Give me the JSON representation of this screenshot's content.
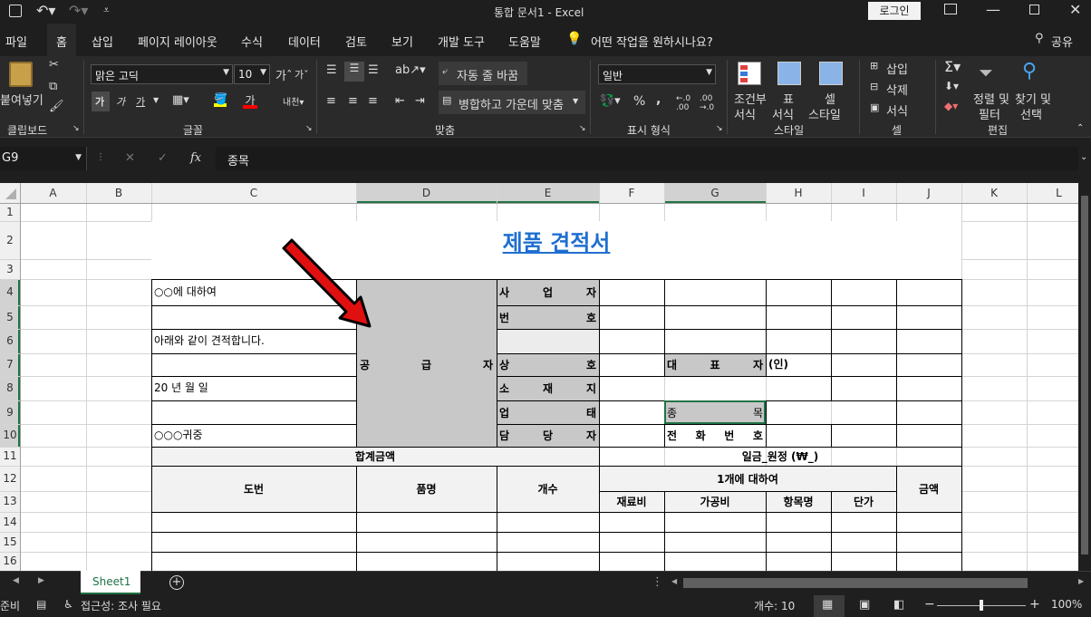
{
  "titlebar": {
    "title": "통합 문서1  -  Excel",
    "login": "로그인",
    "undo_icon": "undo-icon",
    "redo_icon": "redo-icon"
  },
  "menu": {
    "tabs": [
      "파일",
      "홈",
      "삽입",
      "페이지 레이아웃",
      "수식",
      "데이터",
      "검토",
      "보기",
      "개발 도구",
      "도움말"
    ],
    "tell": "어떤 작업을 원하시나요?",
    "share": "공유"
  },
  "ribbon": {
    "paste": "붙여넣기",
    "clipboard": "클립보드",
    "font_name": "맑은 고딕",
    "font_size": "10",
    "bold": "가",
    "italic": "가",
    "underline": "가",
    "font_group": "글꼴",
    "wrap": "자동 줄 바꿈",
    "merge": "병합하고 가운데 맞춤",
    "align_group": "맞춤",
    "numfmt": "일반",
    "percent": "%",
    "comma": ",",
    "number_group": "표시 형식",
    "cond1": "조건부",
    "cond2": "서식",
    "table1": "표",
    "table2": "서식",
    "cell1": "셀",
    "cell2": "스타일",
    "style_group": "스타일",
    "insert": "삽입",
    "delete": "삭제",
    "format": "서식",
    "cells_group": "셀",
    "sort1": "정렬 및",
    "sort2": "필터",
    "find1": "찾기 및",
    "find2": "선택",
    "edit_group": "편집"
  },
  "formula": {
    "name_box": "G9",
    "fx": "fx",
    "value": "종목"
  },
  "columns": [
    "A",
    "B",
    "C",
    "D",
    "E",
    "F",
    "G",
    "H",
    "I",
    "J",
    "K",
    "L"
  ],
  "rows": [
    "1",
    "2",
    "3",
    "4",
    "5",
    "6",
    "7",
    "8",
    "9",
    "10",
    "11",
    "12",
    "13",
    "14",
    "15",
    "16"
  ],
  "cells": {
    "title": "제품 견적서",
    "c4": "○○에 대하여",
    "c6": "아래와 같이 견적합니다.",
    "c8": "20 년 월 일",
    "c10": "○○○귀중",
    "supplier": [
      "공",
      "급",
      "자"
    ],
    "e4": [
      "사",
      "업",
      "자"
    ],
    "e5": [
      "번",
      "호"
    ],
    "e7": [
      "상",
      "호"
    ],
    "e8": [
      "소",
      "재",
      "지"
    ],
    "e9": [
      "업",
      "태"
    ],
    "e10": [
      "담",
      "당",
      "자"
    ],
    "g7": [
      "대",
      "표",
      "자"
    ],
    "h7": "(인)",
    "g9": [
      "종",
      "목"
    ],
    "g10": [
      "전",
      "화",
      "번",
      "호"
    ],
    "total": "합계금액",
    "total_text": "일금_원정 (₩_)",
    "doban": "도번",
    "pumname": "품명",
    "count": "개수",
    "per_one": "1개에 대하여",
    "amount": "금액",
    "material": "재료비",
    "processing": "가공비",
    "item": "항목명",
    "unit": "단가"
  },
  "sheet_tab": "Sheet1",
  "status": {
    "ready": "준비",
    "access": "접근성: 조사 필요",
    "count": "개수: 10",
    "zoom": "100%"
  }
}
